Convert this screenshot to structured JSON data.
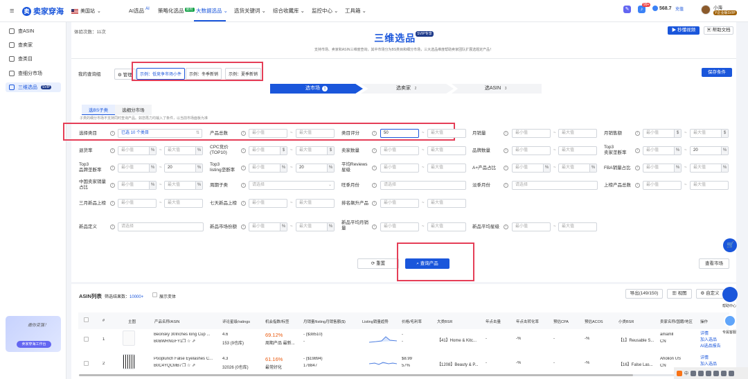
{
  "app": {
    "logo": "卖家穿海",
    "site": "美国站"
  },
  "nav": {
    "items": [
      "AI选品",
      "策略化选品",
      "大数据选品",
      "选货关键词",
      "综合收藏库",
      "监控中心",
      "工具箱"
    ],
    "ai_tag": "AI",
    "new_tag": "限时"
  },
  "user": {
    "points": "568.7",
    "recharge": "充值",
    "name": "小海",
    "tag": "Y企业版SVIP",
    "badge": "99+"
  },
  "sidebar": {
    "items": [
      "查ASIN",
      "查卖家",
      "查类目",
      "查细分市场",
      "三维选品"
    ],
    "svip": "SVIP",
    "promo_text": "邀你变强！",
    "promo_btn": "卖家穿海工作台"
  },
  "page": {
    "count": "体验次数：11次",
    "title": "三维选品",
    "svip": "SVIP专享",
    "subtitle": "支持市场、卖家和ASIN三维度查询，其中市场分为BS类目和细分市场，三大选品维度帮助卖家团队扩展选题定产品！",
    "video_btn": "秒懂视频",
    "help_btn": "帮助文档"
  },
  "query": {
    "label": "我的查询组",
    "manage": "管理",
    "examples": [
      "示例：低竞争市场小件",
      "示例：冬季新销",
      "示例：夏季新销"
    ],
    "save": "保存条件"
  },
  "steps": [
    "选市场",
    "选卖家",
    "选ASIN"
  ],
  "step_nums": [
    "1",
    "2",
    "3"
  ],
  "subtabs": [
    "选BS子类",
    "选细分市场"
  ],
  "hint": "子类的细分市场不支持同时查询产品。如您再力均输入了条件，以当前市场面板为准",
  "filters": {
    "r1": [
      "选择类目",
      "产品总数",
      "类目评分",
      "月销量",
      "月销售额"
    ],
    "r2": [
      "退货率",
      "CPC竞价\n(TOP10)",
      "卖家数量",
      "品牌数量",
      "Top3\n卖家垄断率"
    ],
    "r3": [
      "Top3\n品牌垄断率",
      "Top3\nlisting垄断率",
      "平均Reviews\n星级",
      "A+产品占比",
      "FBA销量占比"
    ],
    "r4": [
      "中国卖家销量\n占比",
      "周期子类",
      "旺季月份",
      "淡季月份",
      "上榜产品总数"
    ],
    "r5": [
      "三月新品上榜",
      "七天新品上榜",
      "排名飙升产品"
    ],
    "r6": [
      "新品定义",
      "新品市场份额",
      "新品平均月销\n量",
      "新品平均星级"
    ],
    "selected": "已选 10 个类目",
    "min": "最小值",
    "max": "最大值",
    "select": "请选择",
    "v20": "20",
    "rating_val": "50",
    "unit": "$",
    "unit_pct": "%"
  },
  "actions": {
    "reset": "重置",
    "search": "查询产品",
    "lookup": "查看市场"
  },
  "table": {
    "title": "ASIN列表",
    "result_label": "筛选结果数：",
    "result_count": "10000+",
    "variant": "展示变体",
    "export": "导出(149/150)",
    "view": "视图",
    "custom": "自定义",
    "headers": [
      "#",
      "主图",
      "产品名称/ASIN",
      "评论星级/ratings",
      "机会指数/标签",
      "月销量/listing月销售额($)",
      "Listing销量趋势",
      "价格/毛利率",
      "大类BSR",
      "年点击量",
      "年点击转化率",
      "预估CPA",
      "预估ACOS",
      "小类BSR",
      "卖家名称/国籍/地区",
      "操作"
    ],
    "rows": [
      {
        "n": "1",
        "name": "Beonsky 30Inches long Cup ...",
        "asin": "B0BWRNGFY1",
        "rating": "4.6",
        "ratings": "153 (9也库)",
        "score": "69.12%",
        "tag": "周期产品 最新...",
        "sales": "-  ($38510)",
        "sales2": "-",
        "price": "-",
        "price2": "-",
        "bsr": "【41】Home & Kitc...",
        "clicks": "-",
        "conv": "-%",
        "cpa": "-",
        "acos": "-%",
        "sbsr": "【1】Reusable S...",
        "seller": "amamll",
        "country": "CN",
        "ops": [
          "详情",
          "加入选品",
          "AI选品报告"
        ]
      },
      {
        "n": "2",
        "name": "Pooplunch False Eyelashes C...",
        "asin": "B0C4YQCMB7",
        "rating": "4.3",
        "ratings": "32026 (0也库)",
        "score": "61.16%",
        "tag": "最常好化",
        "sales": "-  ($19894)",
        "sales2": "178847",
        "price": "$8.99",
        "price2": "57%",
        "bsr": "【1208】Beauty & P...",
        "clicks": "-",
        "conv": "-%",
        "cpa": "-",
        "acos": "-%",
        "sbsr": "【16】False Las...",
        "seller": "Aholion US",
        "country": "CN",
        "ops": [
          "详情",
          "加入选品"
        ]
      }
    ]
  },
  "dock": {
    "help": "帮助中心",
    "service": "专属客服"
  }
}
